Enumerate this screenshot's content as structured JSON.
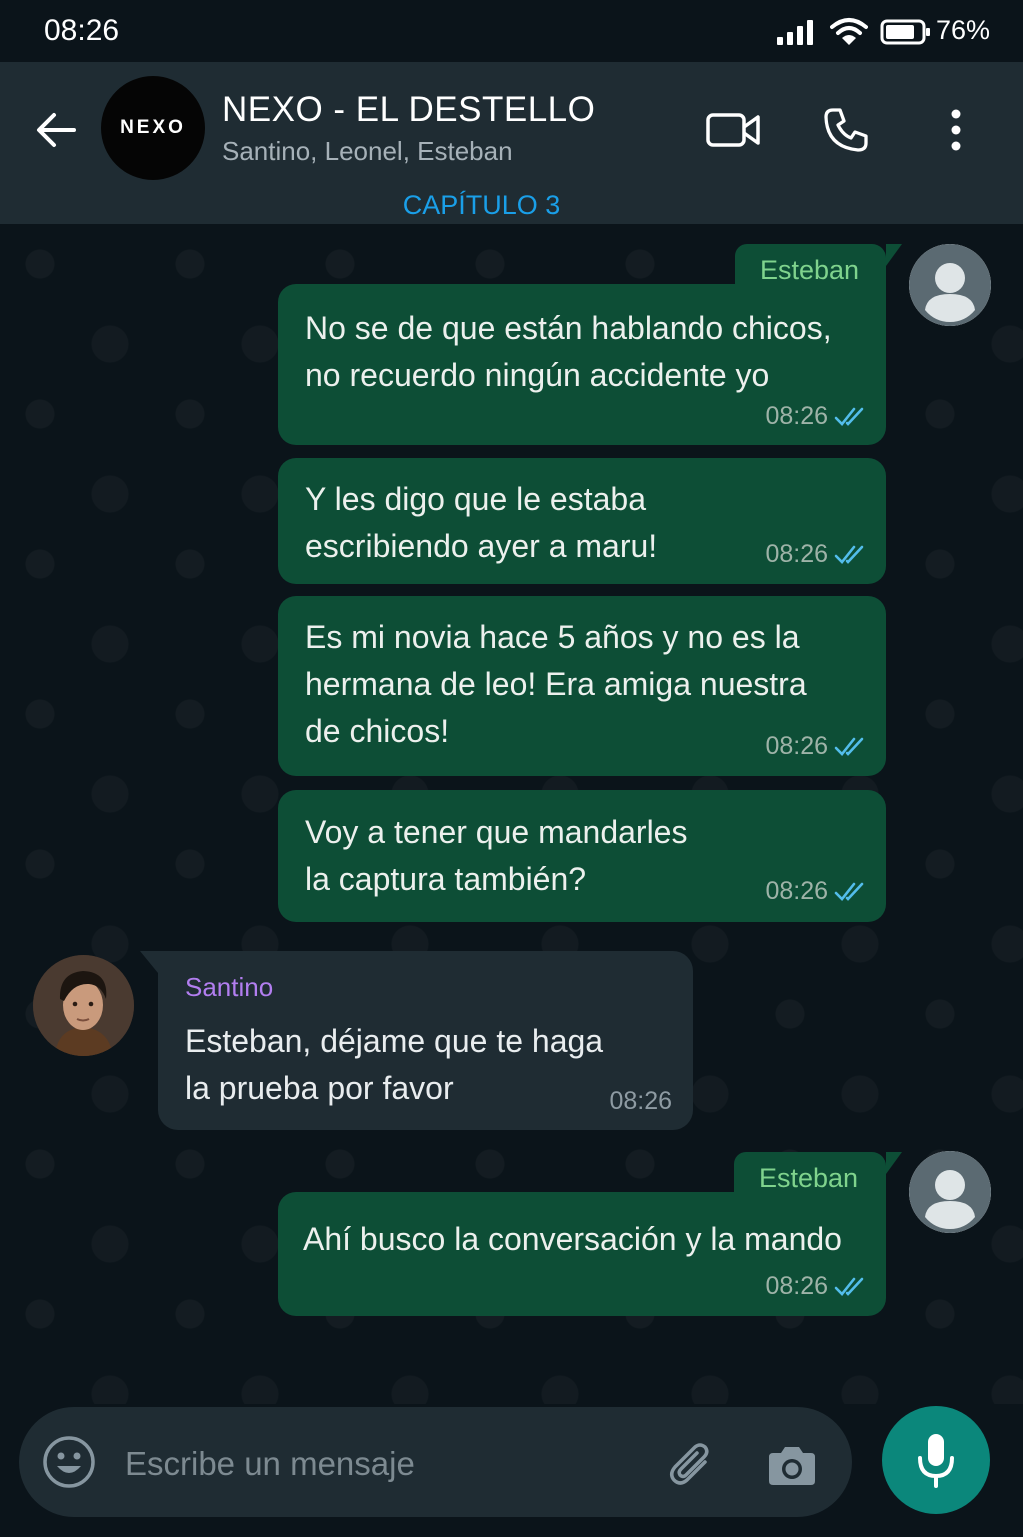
{
  "status_bar": {
    "time": "08:26",
    "battery": "76%"
  },
  "header": {
    "group_logo": "NEXO",
    "title": "NEXO - EL DESTELLO",
    "members": "Santino, Leonel, Esteban",
    "chapter": "CAPÍTULO 3"
  },
  "messages": [
    {
      "sender": "Esteban",
      "direction": "outgoing",
      "lines": [
        "No se de que están hablando chicos,",
        "no recuerdo ningún accidente yo"
      ],
      "time": "08:26",
      "status": "read"
    },
    {
      "direction": "outgoing",
      "lines": [
        "Y les digo que le estaba",
        "escribiendo ayer a maru!"
      ],
      "time": "08:26",
      "status": "read"
    },
    {
      "direction": "outgoing",
      "lines": [
        "Es mi novia hace 5 años y no es la",
        "hermana de leo! Era amiga nuestra",
        "de chicos!"
      ],
      "time": "08:26",
      "status": "read"
    },
    {
      "direction": "outgoing",
      "lines": [
        "Voy a tener que mandarles",
        "la captura también?"
      ],
      "time": "08:26",
      "status": "read"
    },
    {
      "sender": "Santino",
      "direction": "incoming",
      "lines": [
        "Esteban, déjame que te haga",
        "la prueba por favor"
      ],
      "time": "08:26"
    },
    {
      "sender": "Esteban",
      "direction": "outgoing",
      "lines": [
        "Ahí busco la conversación y la mando"
      ],
      "time": "08:26",
      "status": "read"
    }
  ],
  "composer": {
    "placeholder": "Escribe un mensaje"
  },
  "colors": {
    "outgoing_bubble": "#0d4e36",
    "incoming_bubble": "#1f2c33",
    "header": "#1f2c33",
    "background": "#0b141a",
    "read_ticks": "#53bdeb",
    "accent": "#0b877b",
    "esteban_name": "#7fd38d",
    "santino_name": "#b27ef0",
    "chapter_link": "#1a9fe8"
  }
}
